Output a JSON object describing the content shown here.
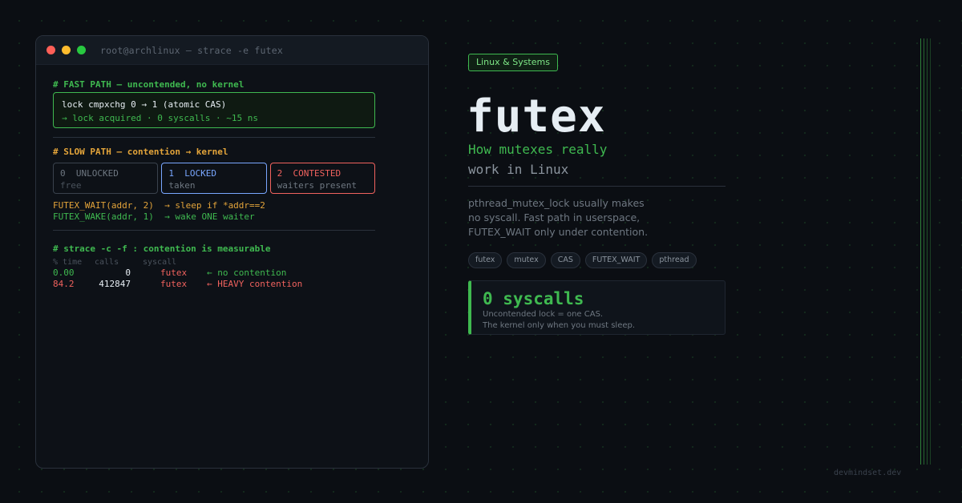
{
  "terminal": {
    "title": "root@archlinux  —  strace -e futex",
    "traffic_colors": [
      "#ff5f57",
      "#febc2e",
      "#28c840"
    ],
    "fast_path": {
      "header": "# FAST PATH — uncontended, no kernel",
      "cmd": "lock cmpxchg  0 → 1   (atomic CAS)",
      "result": "→ lock acquired · 0 syscalls · ~15 ns"
    },
    "slow_path": {
      "header": "# SLOW PATH — contention → kernel",
      "states": [
        {
          "code": "0",
          "name": "UNLOCKED",
          "desc": "free"
        },
        {
          "code": "1",
          "name": "LOCKED",
          "desc": "taken"
        },
        {
          "code": "2",
          "name": "CONTESTED",
          "desc": "waiters present"
        }
      ],
      "wait_call": "FUTEX_WAIT(addr, 2)",
      "wait_desc": "→ sleep if *addr==2",
      "wake_call": "FUTEX_WAKE(addr, 1)",
      "wake_desc": "→ wake ONE waiter"
    },
    "strace": {
      "header": "# strace -c -f : contention is measurable",
      "columns": [
        "% time",
        "calls",
        "syscall"
      ],
      "rows": [
        {
          "time": "0.00",
          "calls": "0",
          "syscall": "futex",
          "note": "← no contention"
        },
        {
          "time": "84.2",
          "calls": "412847",
          "syscall": "futex",
          "note": "← HEAVY contention"
        }
      ]
    }
  },
  "panel": {
    "category": "Linux & Systems",
    "title": "futex",
    "subtitle_1": "How mutexes really",
    "subtitle_2": "work in Linux",
    "description": [
      "pthread_mutex_lock usually makes",
      "no syscall. Fast path in userspace,",
      "FUTEX_WAIT only under contention."
    ],
    "tags": [
      "futex",
      "mutex",
      "CAS",
      "FUTEX_WAIT",
      "pthread"
    ],
    "stat": {
      "value": "0 syscalls",
      "line1": "Uncontended lock = one CAS.",
      "line2": "The kernel only when you must sleep."
    }
  },
  "footer": "devmindset.dev",
  "colors": {
    "accent": "#3fb950",
    "warn": "#e3a43a",
    "info": "#79a7ff",
    "danger": "#f0625e",
    "background": "#0b0e13"
  }
}
